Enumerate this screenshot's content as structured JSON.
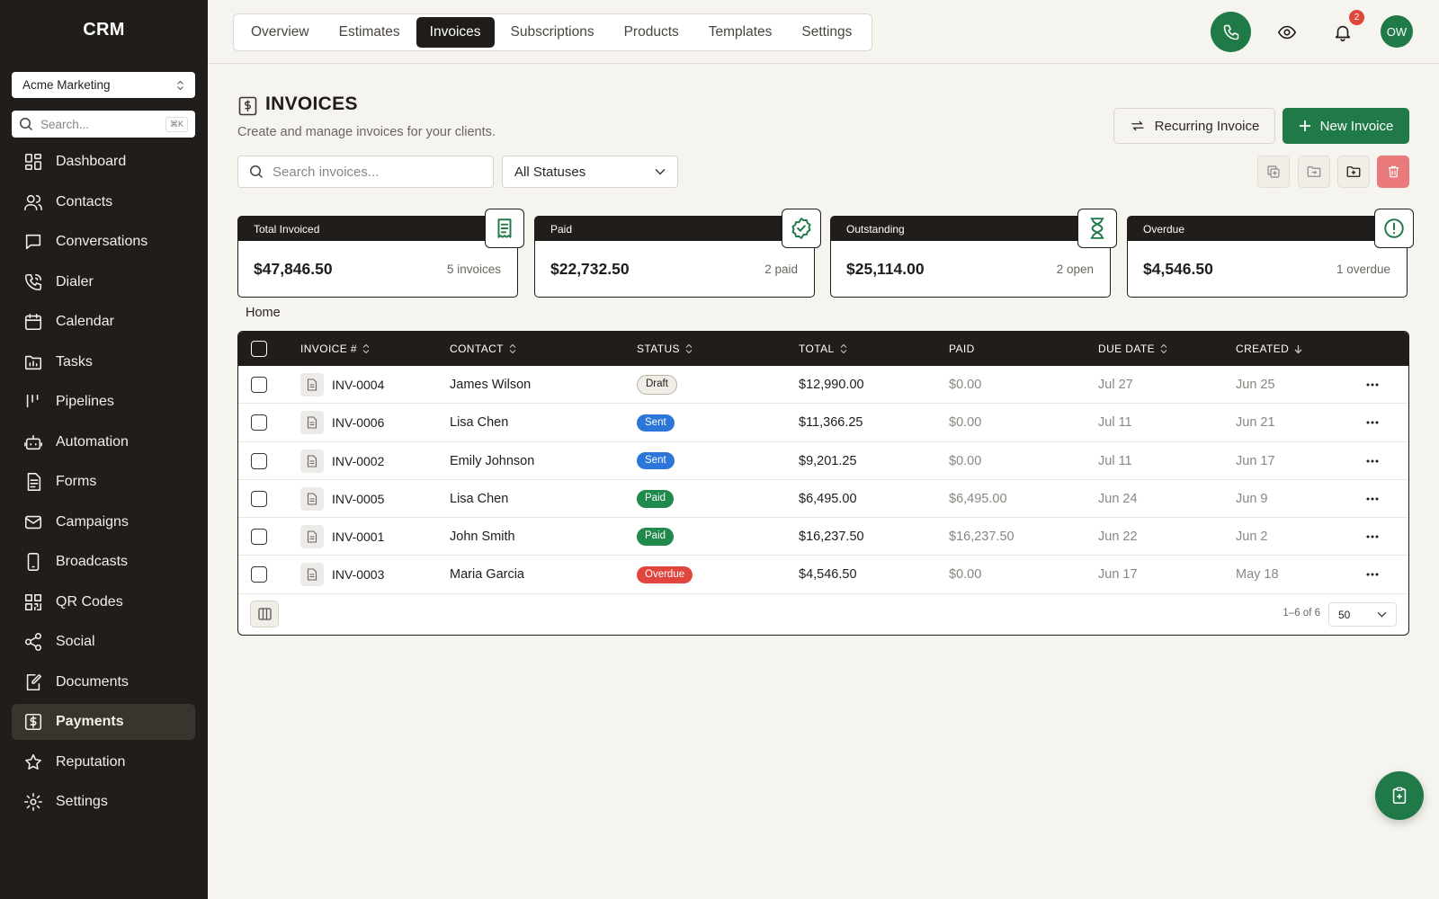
{
  "app": {
    "brand": "CRM"
  },
  "sidebar": {
    "account": "Acme Marketing",
    "search_placeholder": "Search...",
    "search_shortcut": "⌘K",
    "items": [
      {
        "label": "Dashboard",
        "icon": "dashboard-icon"
      },
      {
        "label": "Contacts",
        "icon": "contacts-icon"
      },
      {
        "label": "Conversations",
        "icon": "chat-icon"
      },
      {
        "label": "Dialer",
        "icon": "phone-icon"
      },
      {
        "label": "Calendar",
        "icon": "calendar-icon"
      },
      {
        "label": "Tasks",
        "icon": "folder-icon"
      },
      {
        "label": "Pipelines",
        "icon": "pipeline-icon"
      },
      {
        "label": "Automation",
        "icon": "robot-icon"
      },
      {
        "label": "Forms",
        "icon": "form-icon"
      },
      {
        "label": "Campaigns",
        "icon": "mail-icon"
      },
      {
        "label": "Broadcasts",
        "icon": "mobile-icon"
      },
      {
        "label": "QR Codes",
        "icon": "qr-icon"
      },
      {
        "label": "Social",
        "icon": "share-icon"
      },
      {
        "label": "Documents",
        "icon": "edit-doc-icon"
      },
      {
        "label": "Payments",
        "icon": "payments-icon",
        "active": true
      },
      {
        "label": "Reputation",
        "icon": "star-icon"
      },
      {
        "label": "Settings",
        "icon": "gear-icon"
      }
    ]
  },
  "topbar": {
    "tabs": [
      "Overview",
      "Estimates",
      "Invoices",
      "Subscriptions",
      "Products",
      "Templates",
      "Settings"
    ],
    "active_tab": "Invoices",
    "notification_count": "2",
    "avatar_initials": "OW"
  },
  "header": {
    "title": "INVOICES",
    "subtitle": "Create and manage invoices for your clients.",
    "recurring_label": "Recurring Invoice",
    "new_label": "New Invoice"
  },
  "filters": {
    "search_placeholder": "Search invoices...",
    "status_value": "All Statuses"
  },
  "stats": [
    {
      "label": "Total Invoiced",
      "value": "$47,846.50",
      "note": "5 invoices",
      "icon": "receipt-icon"
    },
    {
      "label": "Paid",
      "value": "$22,732.50",
      "note": "2 paid",
      "icon": "check-badge-icon"
    },
    {
      "label": "Outstanding",
      "value": "$25,114.00",
      "note": "2 open",
      "icon": "hourglass-icon"
    },
    {
      "label": "Overdue",
      "value": "$4,546.50",
      "note": "1 overdue",
      "icon": "alert-icon"
    }
  ],
  "breadcrumb": "Home",
  "table": {
    "columns": [
      "INVOICE #",
      "CONTACT",
      "STATUS",
      "TOTAL",
      "PAID",
      "DUE DATE",
      "CREATED"
    ],
    "rows": [
      {
        "invoice": "INV-0004",
        "contact": "James Wilson",
        "status": "Draft",
        "total": "$12,990.00",
        "paid": "$0.00",
        "due": "Jul 27",
        "created": "Jun 25"
      },
      {
        "invoice": "INV-0006",
        "contact": "Lisa Chen",
        "status": "Sent",
        "total": "$11,366.25",
        "paid": "$0.00",
        "due": "Jul 11",
        "created": "Jun 21"
      },
      {
        "invoice": "INV-0002",
        "contact": "Emily Johnson",
        "status": "Sent",
        "total": "$9,201.25",
        "paid": "$0.00",
        "due": "Jul 11",
        "created": "Jun 17"
      },
      {
        "invoice": "INV-0005",
        "contact": "Lisa Chen",
        "status": "Paid",
        "total": "$6,495.00",
        "paid": "$6,495.00",
        "due": "Jun 24",
        "created": "Jun 9"
      },
      {
        "invoice": "INV-0001",
        "contact": "John Smith",
        "status": "Paid",
        "total": "$16,237.50",
        "paid": "$16,237.50",
        "due": "Jun 22",
        "created": "Jun 2"
      },
      {
        "invoice": "INV-0003",
        "contact": "Maria Garcia",
        "status": "Overdue",
        "total": "$4,546.50",
        "paid": "$0.00",
        "due": "Jun 17",
        "created": "May 18"
      }
    ],
    "range_text": "1–6 of 6",
    "per_page": "50"
  },
  "colors": {
    "accent": "#1f7a48",
    "sidebar": "#201d1a",
    "sent": "#2b76d8",
    "overdue": "#e1463e"
  }
}
